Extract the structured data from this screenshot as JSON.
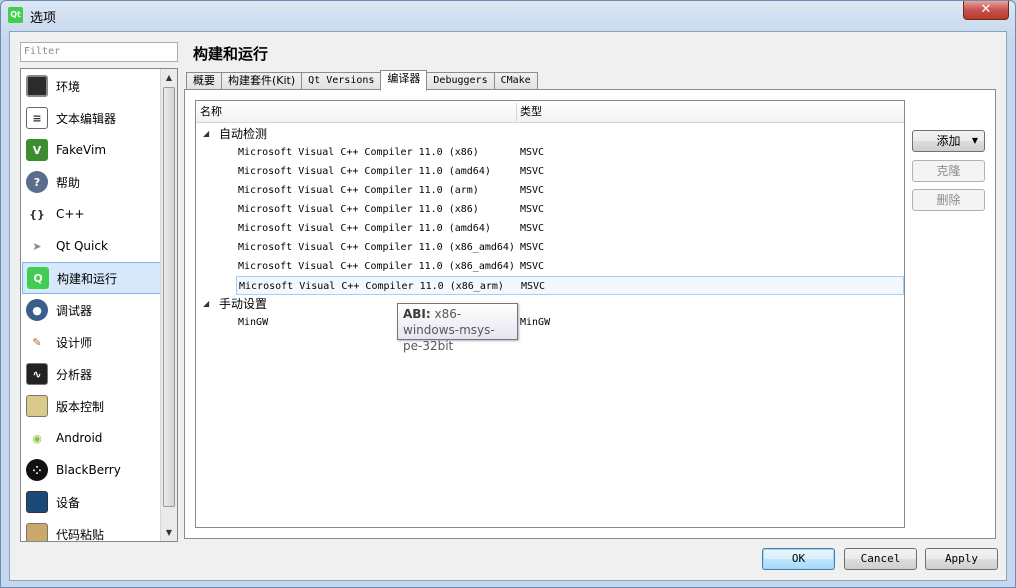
{
  "window": {
    "title": "选项",
    "app_icon": "Qt",
    "close_glyph": "✕"
  },
  "filter": {
    "placeholder": "Filter"
  },
  "categories": [
    {
      "label": "环境",
      "icon": "monitor-icon"
    },
    {
      "label": "文本编辑器",
      "icon": "text-document-icon"
    },
    {
      "label": "FakeVim",
      "icon": "fakevim-icon"
    },
    {
      "label": "帮助",
      "icon": "help-icon"
    },
    {
      "label": "C++",
      "icon": "braces-icon"
    },
    {
      "label": "Qt Quick",
      "icon": "paper-plane-icon"
    },
    {
      "label": "构建和运行",
      "icon": "build-run-icon"
    },
    {
      "label": "调试器",
      "icon": "debugger-icon"
    },
    {
      "label": "设计师",
      "icon": "designer-icon"
    },
    {
      "label": "分析器",
      "icon": "analyzer-icon"
    },
    {
      "label": "版本控制",
      "icon": "version-control-icon"
    },
    {
      "label": "Android",
      "icon": "android-icon"
    },
    {
      "label": "BlackBerry",
      "icon": "blackberry-icon"
    },
    {
      "label": "设备",
      "icon": "device-icon"
    },
    {
      "label": "代码粘贴",
      "icon": "clipboard-icon"
    }
  ],
  "selected_category": "构建和运行",
  "page": {
    "title": "构建和运行",
    "tabs": [
      "概要",
      "构建套件(Kit)",
      "Qt Versions",
      "编译器",
      "Debuggers",
      "CMake"
    ],
    "active_tab": "编译器"
  },
  "tree": {
    "headers": {
      "name": "名称",
      "type": "类型"
    },
    "groups": [
      {
        "label": "自动检测",
        "rows": [
          {
            "name": "Microsoft Visual C++ Compiler 11.0 (x86)",
            "type": "MSVC"
          },
          {
            "name": "Microsoft Visual C++ Compiler 11.0 (amd64)",
            "type": "MSVC"
          },
          {
            "name": "Microsoft Visual C++ Compiler 11.0 (arm)",
            "type": "MSVC"
          },
          {
            "name": "Microsoft Visual C++ Compiler 11.0 (x86)",
            "type": "MSVC"
          },
          {
            "name": "Microsoft Visual C++ Compiler 11.0 (amd64)",
            "type": "MSVC"
          },
          {
            "name": "Microsoft Visual C++ Compiler 11.0 (x86_amd64)",
            "type": "MSVC"
          },
          {
            "name": "Microsoft Visual C++ Compiler 11.0 (x86_amd64)",
            "type": "MSVC"
          },
          {
            "name": "Microsoft Visual C++ Compiler 11.0 (x86_arm)",
            "type": "MSVC"
          }
        ]
      },
      {
        "label": "手动设置",
        "rows": [
          {
            "name": "MinGW",
            "type": "MinGW"
          }
        ]
      }
    ],
    "selected_row": "Microsoft Visual C++ Compiler 11.0 (x86_arm)"
  },
  "side_buttons": {
    "add": "添加",
    "add_caret": "▼",
    "clone": "克隆",
    "delete": "删除"
  },
  "tooltip": {
    "key": "ABI:",
    "value": "x86-windows-msys-pe-32bit"
  },
  "footer": {
    "ok": "OK",
    "cancel": "Cancel",
    "apply": "Apply"
  },
  "colors": {
    "selection": "#d7e8fb",
    "selection_border": "#7eb4ea",
    "title_gradient": "#c4d7ec",
    "close_red": "#c75050"
  }
}
